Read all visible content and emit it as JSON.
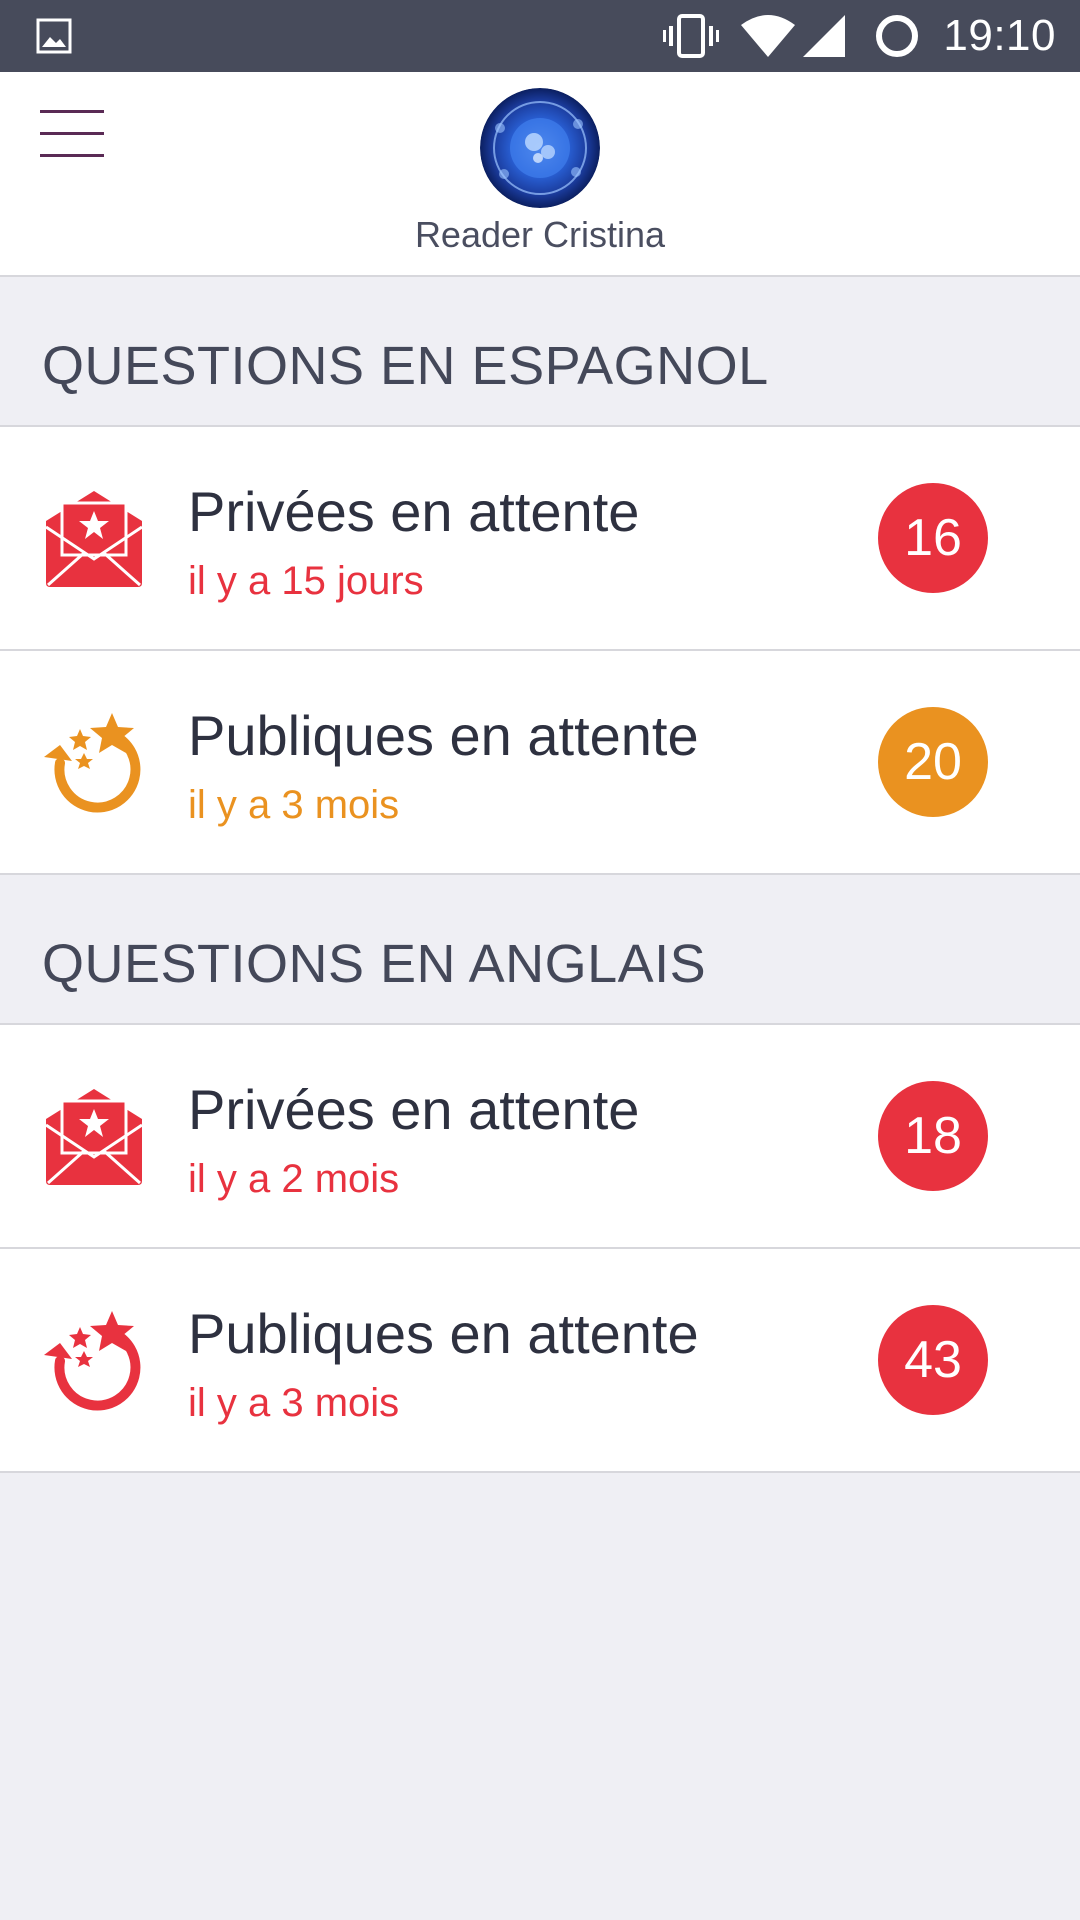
{
  "status_bar": {
    "time": "19:10",
    "icons": [
      "gallery-icon",
      "vibrate-icon",
      "wifi-icon",
      "signal-icon",
      "loading-icon"
    ]
  },
  "header": {
    "menu_icon": "hamburger-menu-icon",
    "reader_name": "Reader Cristina"
  },
  "colors": {
    "red": "#e8323f",
    "orange": "#ea9220",
    "status_bar": "#474b5b",
    "background": "#efeff4"
  },
  "sections": [
    {
      "title": "QUESTIONS EN ESPAGNOL",
      "items": [
        {
          "label": "Privées en attente",
          "time": "il y a 15 jours",
          "count": "16",
          "icon": "private-envelope-star-icon",
          "color": "red"
        },
        {
          "label": "Publiques en attente",
          "time": "il y a 3 mois",
          "count": "20",
          "icon": "public-stars-arrow-icon",
          "color": "orange"
        }
      ]
    },
    {
      "title": "QUESTIONS EN ANGLAIS",
      "items": [
        {
          "label": "Privées en attente",
          "time": "il y a 2 mois",
          "count": "18",
          "icon": "private-envelope-star-icon",
          "color": "red"
        },
        {
          "label": "Publiques en attente",
          "time": "il y a 3 mois",
          "count": "43",
          "icon": "public-stars-arrow-icon",
          "color": "red"
        }
      ]
    }
  ]
}
